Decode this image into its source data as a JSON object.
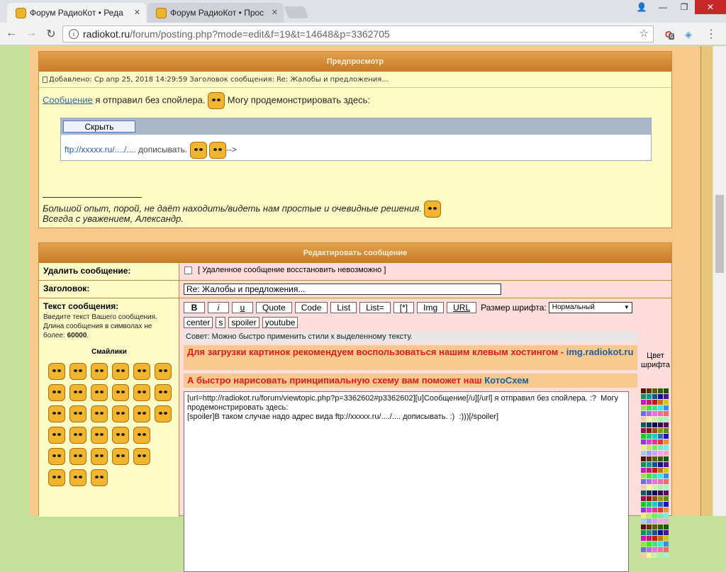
{
  "browser": {
    "tabs": [
      {
        "title": "Форум РадиоКот • Реда"
      },
      {
        "title": "Форум РадиоКот • Прос"
      }
    ],
    "url_host": "radiokot.ru",
    "url_path": "/forum/posting.php?mode=edit&f=19&t=14648&p=3362705",
    "ext_badge": "6"
  },
  "preview": {
    "header": "Предпросмотр",
    "meta": "Добавлено: Ср апр 25, 2018 14:29:59     Заголовок сообщения: Re: Жалобы и предложения...",
    "msg_link": "Сообщение",
    "msg_text1": " я отправил без спойлера. ",
    "msg_text2": " Могу продемонстрировать здесь:",
    "spoiler_button": "Скрыть",
    "spoiler_link": "ftp://xxxxx.ru/..../....",
    "spoiler_text": " дописывать. ",
    "spoiler_tail": "-->",
    "sig_line1": "Большой опыт, порой, не даёт находить/видеть нам простые и очевидные решения. ",
    "sig_line2": "Всегда с уважением, Александр."
  },
  "edit": {
    "header": "Редактировать сообщение",
    "delete_label": "Удалить сообщение:",
    "delete_note": "[ Удаленное сообщение восстановить невозможно ]",
    "subject_label": "Заголовок:",
    "subject_value": "Re: Жалобы и предложения...",
    "text_label": "Текст сообщения:",
    "text_help": "Введите текст Вашего сообщения. Длина сообщения в символах не более: ",
    "text_limit": "60000",
    "smiles_title": "Смайлики",
    "buttons": [
      "B",
      "i",
      "u",
      "Quote",
      "Code",
      "List",
      "List=",
      "[*]",
      "Img",
      "URL"
    ],
    "buttons2": [
      "center",
      "s",
      "spoiler",
      "youtube"
    ],
    "font_size_label": "Размер шрифта:",
    "font_size_value": "Нормальный",
    "tip": "Совет: Можно быстро применить стили к выделенному тексту.",
    "promo1": "Для загрузки картинок рекомендуем воспользоваться нашим клевым хостингом - ",
    "promo1_link": "img.radiokot.ru",
    "promo2": "А быстро нарисовать принципиальную схему вам поможет наш ",
    "promo2_link": "КотоСхем",
    "textarea": "[url=http://radiokot.ru/forum/viewtopic.php?p=3362602#p3362602][u]Сообщение[/u][/url] я отправил без спойлера. :?  Могу продемонстрировать здесь:\n[spoiler]В таком случае надо адрес вида ftp://xxxxx.ru/..../.... дописывать. :)  :)))[/spoiler]",
    "color_title": "Цвет шрифта"
  }
}
